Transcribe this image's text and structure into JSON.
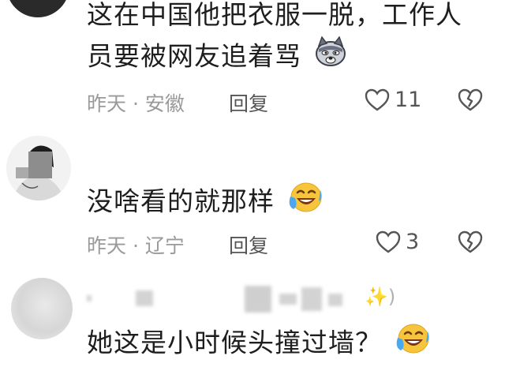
{
  "comments": [
    {
      "line1": "这在中国他把衣服一脱，工作人",
      "line2": "员要被网友追着骂",
      "emoji": "doge-icon",
      "meta": "昨天 · 安徽",
      "reply": "回复",
      "likes": "11"
    },
    {
      "text": "没啥看的就那样",
      "emoji": "laugh-cry-icon",
      "meta": "昨天 · 辽宁",
      "reply": "回复",
      "likes": "3"
    },
    {
      "username_suffix": "✨)",
      "text": "她这是小时候头撞过墙？",
      "emoji": "laugh-cry-icon"
    }
  ],
  "colors": {
    "meta": "#9a9a9a",
    "text": "#1e1e1e",
    "icon": "#555555"
  }
}
